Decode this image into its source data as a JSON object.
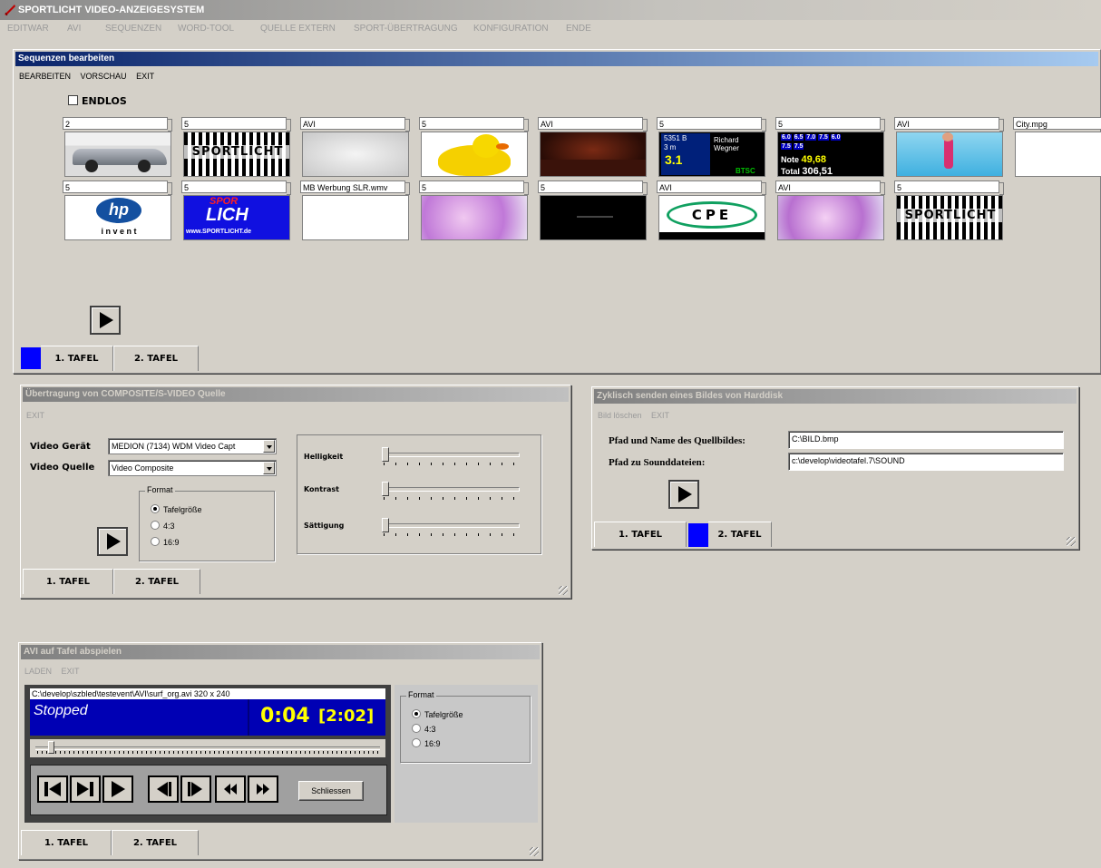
{
  "app": {
    "title": "SPORTLICHT VIDEO-ANZEIGESYSTEM",
    "menu": [
      "EDITWAR",
      "AVI",
      "SEQUENZEN",
      "WORD-TOOL",
      "QUELLE EXTERN",
      "SPORT-ÜBERTRAGUNG",
      "KONFIGURATION",
      "ENDE"
    ]
  },
  "sequences": {
    "title": "Sequenzen bearbeiten",
    "menu": [
      "BEARBEITEN",
      "VORSCHAU",
      "EXIT"
    ],
    "endlos_label": "ENDLOS",
    "tiles_row1": [
      {
        "label": "2",
        "thumb": "car"
      },
      {
        "label": "5",
        "thumb": "sportlicht"
      },
      {
        "label": "AVI",
        "thumb": "grey"
      },
      {
        "label": "5",
        "thumb": "duck"
      },
      {
        "label": "AVI",
        "thumb": "stage"
      },
      {
        "label": "5",
        "thumb": "score"
      },
      {
        "label": "5",
        "thumb": "scoreboard"
      },
      {
        "label": "AVI",
        "thumb": "swimmer"
      },
      {
        "label": "City.mpg",
        "thumb": "white"
      }
    ],
    "tiles_row2": [
      {
        "label": "5",
        "thumb": "hp"
      },
      {
        "label": "5",
        "thumb": "sportlicht-blue"
      },
      {
        "label": "MB Werbung SLR.wmv",
        "thumb": "white"
      },
      {
        "label": "5",
        "thumb": "pink"
      },
      {
        "label": "5",
        "thumb": "black"
      },
      {
        "label": "AVI",
        "thumb": "cpe"
      },
      {
        "label": "AVI",
        "thumb": "pink"
      },
      {
        "label": "5",
        "thumb": "sportlicht"
      }
    ],
    "thumb_text": {
      "score_left": "5351 B",
      "score_left2": "3 m",
      "score_big": "3.1",
      "score_name": "Richard Wegner",
      "score_corner": "BTSC",
      "board_vals": [
        "6.0",
        "6.5",
        "7.0",
        "7.5",
        "6.0",
        "7.5",
        "7.5"
      ],
      "board_note": "Note",
      "board_note_val": "49,68",
      "board_total": "Total",
      "board_total_val": "306,51",
      "hp_main": "hp",
      "hp_sub": "i n v e n t",
      "sportlicht_word": "SPORTLICHT",
      "sport_blue_top": "SPOR",
      "sport_blue_mid": "LICH",
      "sport_blue_url": "www.SPORTLICHT.de",
      "cpe": "CPE"
    },
    "tabs": [
      "1. TAFEL",
      "2. TAFEL"
    ]
  },
  "composite": {
    "title": "Übertragung von COMPOSITE/S-VIDEO Quelle",
    "menu": [
      "EXIT"
    ],
    "video_device_label": "Video Gerät",
    "video_device_value": "MEDION (7134) WDM Video Capt",
    "video_source_label": "Video Quelle",
    "video_source_value": "Video Composite",
    "format_title": "Format",
    "format_options": [
      "Tafelgröße",
      "4:3",
      "16:9"
    ],
    "sliders": [
      "Helligkeit",
      "Kontrast",
      "Sättigung"
    ],
    "tabs": [
      "1. TAFEL",
      "2. TAFEL"
    ]
  },
  "cyclic": {
    "title": "Zyklisch senden eines Bildes von Harddisk",
    "menu": [
      "Bild löschen",
      "EXIT"
    ],
    "path_label": "Pfad und Name des Quellbildes:",
    "path_value": "C:\\BILD.bmp",
    "sound_label": "Pfad zu Sounddateien:",
    "sound_value": "c:\\develop\\videotafel.7\\SOUND",
    "tabs": [
      "1. TAFEL",
      "2. TAFEL"
    ]
  },
  "avi": {
    "title": "AVI auf Tafel abspielen",
    "menu": [
      "LADEN",
      "EXIT"
    ],
    "file_line": "C:\\develop\\szbled\\testevent\\AVI\\surf_org.avi  320 x 240",
    "status": "Stopped",
    "time": "0:04",
    "duration": "[2:02]",
    "close_label": "Schliessen",
    "format_title": "Format",
    "format_options": [
      "Tafelgröße",
      "4:3",
      "16:9"
    ],
    "tabs": [
      "1. TAFEL",
      "2. TAFEL"
    ]
  },
  "colors": {
    "active_tab_marker": "#0000ff",
    "title_active": "#0a246a",
    "player_blue": "#0000b4",
    "player_time": "#ffff00"
  }
}
